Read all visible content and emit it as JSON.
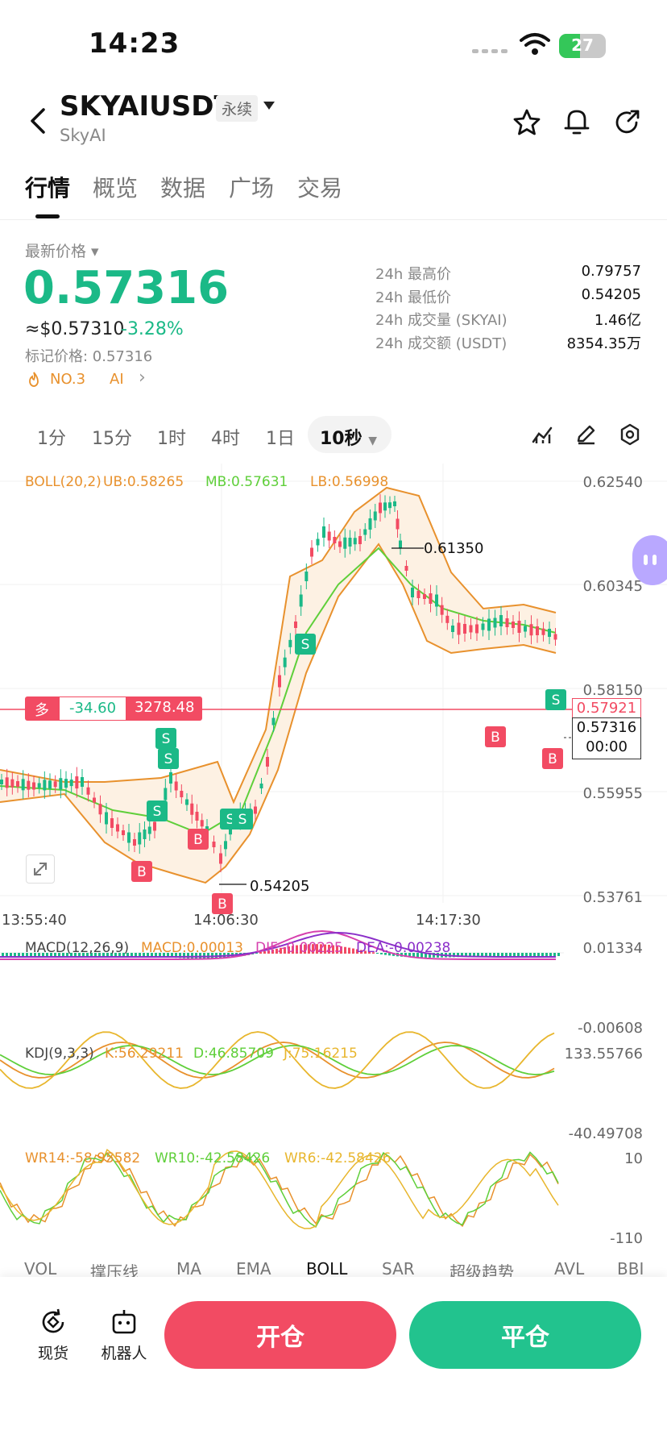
{
  "status": {
    "time": "14:23",
    "battery": "27"
  },
  "header": {
    "symbol": "SKYAIUSDT",
    "contract": "永续",
    "name": "SkyAI"
  },
  "tabs": [
    "行情",
    "概览",
    "数据",
    "广场",
    "交易"
  ],
  "price": {
    "label": "最新价格",
    "last": "0.57316",
    "usd": "≈$0.57310",
    "change": "-3.28%",
    "mark": "标记价格: 0.57316",
    "rank": "NO.3",
    "ai": "AI"
  },
  "stats": [
    {
      "label": "24h 最高价",
      "value": "0.79757"
    },
    {
      "label": "24h 最低价",
      "value": "0.54205"
    },
    {
      "label": "24h 成交量 (SKYAI)",
      "value": "1.46亿"
    },
    {
      "label": "24h 成交额 (USDT)",
      "value": "8354.35万"
    }
  ],
  "timeframes": [
    "1分",
    "15分",
    "1时",
    "4时",
    "1日",
    "10秒"
  ],
  "boll": {
    "name": "BOLL(20,2)",
    "ub": "UB:0.58265",
    "mb": "MB:0.57631",
    "lb": "LB:0.56998"
  },
  "main_y": [
    "0.62540",
    "0.60345",
    "0.58150",
    "0.55955",
    "0.53761"
  ],
  "x_times": [
    "13:55:40",
    "14:06:30",
    "14:17:30"
  ],
  "annotations": {
    "high": "0.61350",
    "low": "0.54205",
    "current_red": "0.57921",
    "current": "0.57316",
    "countdown": "00:00"
  },
  "position_bar": {
    "side": "多",
    "pnl": "-34.60",
    "price": "3278.48"
  },
  "macd": {
    "name": "MACD(12,26,9)",
    "macd": "MACD:0.00013",
    "dif": "DIF:-0.00225",
    "dea": "DEA:-0.00238",
    "y_top": "0.01334",
    "y_bot": "-0.00608"
  },
  "kdj": {
    "name": "KDJ(9,3,3)",
    "k": "K:56.29211",
    "d": "D:46.85709",
    "j": "J:75.16215",
    "y_top": "133.55766",
    "y_bot": "-40.49708"
  },
  "wr": {
    "wr14": "WR14:-58.95582",
    "wr10": "WR10:-42.58426",
    "wr6": "WR6:-42.58426",
    "y_top": "10",
    "y_bot": "-110"
  },
  "indicator_tabs": [
    "VOL",
    "撑压线",
    "MA",
    "EMA",
    "BOLL",
    "SAR",
    "超级趋势",
    "AVL",
    "BBI"
  ],
  "bottom": {
    "spot": "现货",
    "robot": "机器人",
    "open": "开仓",
    "close": "平仓"
  },
  "colors": {
    "up": "#1bb987",
    "down": "#f24b63",
    "boll_band": "#e8912d",
    "boll_mid": "#5fcf3a"
  }
}
